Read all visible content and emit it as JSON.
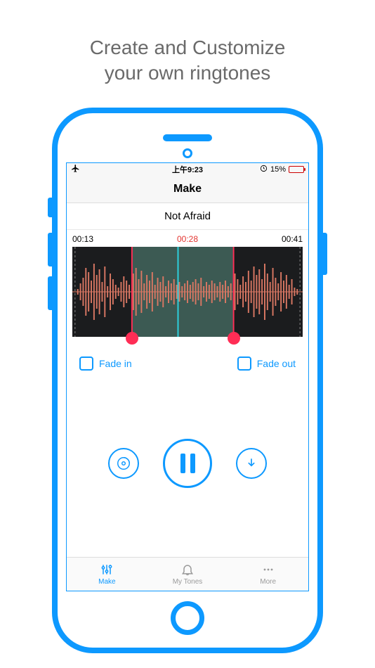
{
  "promo": {
    "line1": "Create and Customize",
    "line2": "your own ringtones"
  },
  "status": {
    "time": "上午9:23",
    "battery_pct": "15%"
  },
  "nav": {
    "title": "Make"
  },
  "song": {
    "title": "Not Afraid"
  },
  "trim": {
    "start": "00:13",
    "duration": "00:28",
    "end": "00:41"
  },
  "fade": {
    "in_label": "Fade in",
    "out_label": "Fade out"
  },
  "tabs": {
    "make": "Make",
    "mytones": "My Tones",
    "more": "More"
  },
  "colors": {
    "accent": "#0d99ff",
    "handle": "#ff2d55",
    "duration": "#e3342f"
  }
}
